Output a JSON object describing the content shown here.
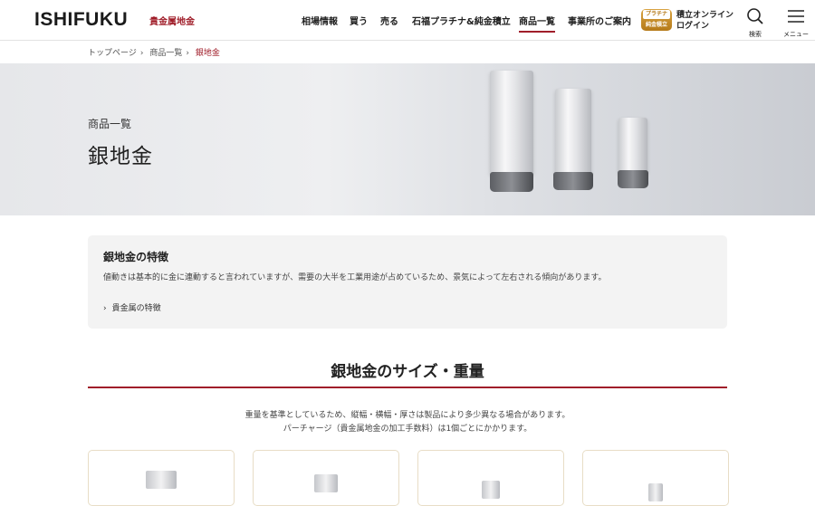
{
  "header": {
    "logo": "ISHIFUKU",
    "logo_sub": "貴金属地金",
    "nav": [
      {
        "label": "相場情報"
      },
      {
        "label": "買う"
      },
      {
        "label": "売る"
      },
      {
        "label": "石福プラチナ&純金積立"
      },
      {
        "label": "商品一覧",
        "active": true
      },
      {
        "label": "事業所のご案内"
      }
    ],
    "tsumitate_badge": {
      "line1": "プラチナ",
      "line2": "純金積立"
    },
    "login": {
      "line1": "積立オンライン",
      "line2": "ログイン"
    },
    "search_label": "検索",
    "menu_label": "メニュー"
  },
  "breadcrumb": [
    "トップページ",
    "商品一覧",
    "銀地金"
  ],
  "hero": {
    "subtitle": "商品一覧",
    "title": "銀地金"
  },
  "feature": {
    "title": "銀地金の特徴",
    "text": "値動きは基本的に金に連動すると言われていますが、需要の大半を工業用途が占めているため、景気によって左右される傾向があります。",
    "link": "貴金属の特徴"
  },
  "section": {
    "title": "銀地金のサイズ・重量",
    "note_line1": "重量を基準としているため、縦幅・横幅・厚さは製品により多少異なる場合があります。",
    "note_line2": "パーチャージ（貴金属地金の加工手数料）は1個ごとにかかります。"
  },
  "colors": {
    "accent": "#a01e2a",
    "card_border": "#e8ddc6",
    "panel_bg": "#f3f3f3"
  },
  "icons": [
    "search-icon",
    "menu-icon",
    "chevron-right-icon",
    "silver-bar-image"
  ]
}
